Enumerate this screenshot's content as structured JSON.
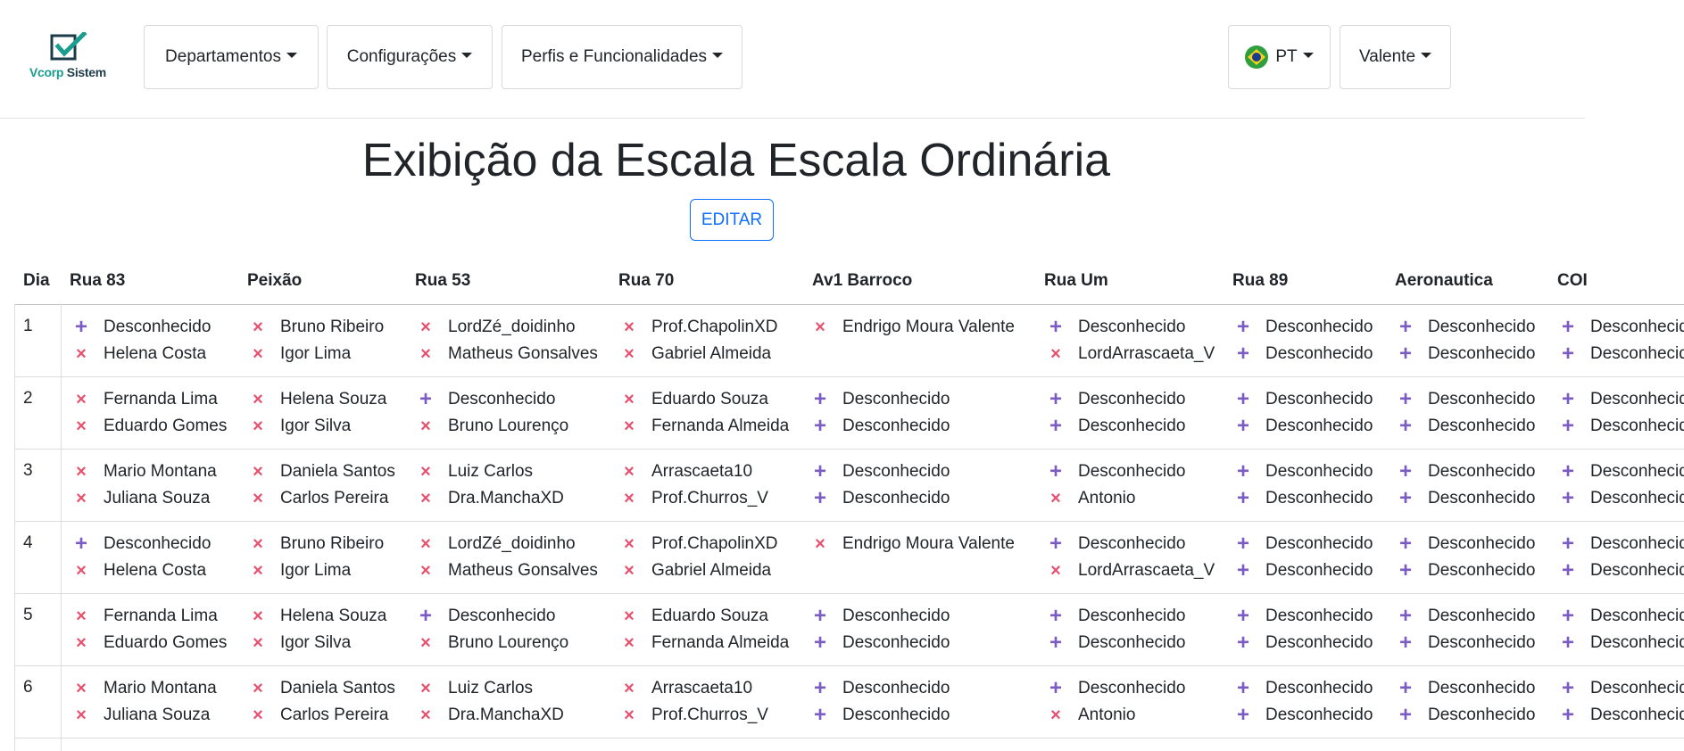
{
  "logo": {
    "part1": "Vcorp",
    "part2": "Sistem"
  },
  "nav": {
    "departamentos": "Departamentos",
    "configuracoes": "Configurações",
    "perfis": "Perfis e Funcionalidades",
    "language": "PT",
    "user": "Valente"
  },
  "page": {
    "title": "Exibição da Escala Escala Ordinária",
    "edit_label": "EDITAR"
  },
  "icons": {
    "x": "×",
    "plus": "+",
    "remove_icon": "x-icon",
    "add_icon": "plus-icon",
    "flag_icon": "brazil-flag-icon"
  },
  "colors": {
    "x": "#e8506d",
    "plus": "#7b5cc4",
    "accent": "#0d6efd",
    "logo_teal": "#1a9c8e"
  },
  "table": {
    "headers": [
      "Dia",
      "Rua 83",
      "Peixão",
      "Rua 53",
      "Rua 70",
      "Av1 Barroco",
      "Rua Um",
      "Rua 89",
      "Aeronautica",
      "COI"
    ],
    "rows": [
      {
        "day": "1",
        "cells": [
          [
            {
              "m": "plus",
              "n": "Desconhecido"
            },
            {
              "m": "x",
              "n": "Helena Costa"
            }
          ],
          [
            {
              "m": "x",
              "n": "Bruno Ribeiro"
            },
            {
              "m": "x",
              "n": "Igor Lima"
            }
          ],
          [
            {
              "m": "x",
              "n": "LordZé_doidinho"
            },
            {
              "m": "x",
              "n": "Matheus Gonsalves"
            }
          ],
          [
            {
              "m": "x",
              "n": "Prof.ChapolinXD"
            },
            {
              "m": "x",
              "n": "Gabriel Almeida"
            }
          ],
          [
            {
              "m": "x",
              "n": "Endrigo Moura Valente"
            }
          ],
          [
            {
              "m": "plus",
              "n": "Desconhecido"
            },
            {
              "m": "x",
              "n": "LordArrascaeta_V"
            }
          ],
          [
            {
              "m": "plus",
              "n": "Desconhecido"
            },
            {
              "m": "plus",
              "n": "Desconhecido"
            }
          ],
          [
            {
              "m": "plus",
              "n": "Desconhecido"
            },
            {
              "m": "plus",
              "n": "Desconhecido"
            }
          ],
          [
            {
              "m": "plus",
              "n": "Desconhecido"
            },
            {
              "m": "plus",
              "n": "Desconhecido"
            }
          ]
        ]
      },
      {
        "day": "2",
        "cells": [
          [
            {
              "m": "x",
              "n": "Fernanda Lima"
            },
            {
              "m": "x",
              "n": "Eduardo Gomes"
            }
          ],
          [
            {
              "m": "x",
              "n": "Helena Souza"
            },
            {
              "m": "x",
              "n": "Igor Silva"
            }
          ],
          [
            {
              "m": "plus",
              "n": "Desconhecido"
            },
            {
              "m": "x",
              "n": "Bruno Lourenço"
            }
          ],
          [
            {
              "m": "x",
              "n": "Eduardo Souza"
            },
            {
              "m": "x",
              "n": "Fernanda Almeida"
            }
          ],
          [
            {
              "m": "plus",
              "n": "Desconhecido"
            },
            {
              "m": "plus",
              "n": "Desconhecido"
            }
          ],
          [
            {
              "m": "plus",
              "n": "Desconhecido"
            },
            {
              "m": "plus",
              "n": "Desconhecido"
            }
          ],
          [
            {
              "m": "plus",
              "n": "Desconhecido"
            },
            {
              "m": "plus",
              "n": "Desconhecido"
            }
          ],
          [
            {
              "m": "plus",
              "n": "Desconhecido"
            },
            {
              "m": "plus",
              "n": "Desconhecido"
            }
          ],
          [
            {
              "m": "plus",
              "n": "Desconhecido"
            },
            {
              "m": "plus",
              "n": "Desconhecido"
            }
          ]
        ]
      },
      {
        "day": "3",
        "cells": [
          [
            {
              "m": "x",
              "n": "Mario Montana"
            },
            {
              "m": "x",
              "n": "Juliana Souza"
            }
          ],
          [
            {
              "m": "x",
              "n": "Daniela Santos"
            },
            {
              "m": "x",
              "n": "Carlos Pereira"
            }
          ],
          [
            {
              "m": "x",
              "n": "Luiz Carlos"
            },
            {
              "m": "x",
              "n": "Dra.ManchaXD"
            }
          ],
          [
            {
              "m": "x",
              "n": "Arrascaeta10"
            },
            {
              "m": "x",
              "n": "Prof.Churros_V"
            }
          ],
          [
            {
              "m": "plus",
              "n": "Desconhecido"
            },
            {
              "m": "plus",
              "n": "Desconhecido"
            }
          ],
          [
            {
              "m": "plus",
              "n": "Desconhecido"
            },
            {
              "m": "x",
              "n": "Antonio"
            }
          ],
          [
            {
              "m": "plus",
              "n": "Desconhecido"
            },
            {
              "m": "plus",
              "n": "Desconhecido"
            }
          ],
          [
            {
              "m": "plus",
              "n": "Desconhecido"
            },
            {
              "m": "plus",
              "n": "Desconhecido"
            }
          ],
          [
            {
              "m": "plus",
              "n": "Desconhecido"
            },
            {
              "m": "plus",
              "n": "Desconhecido"
            }
          ]
        ]
      },
      {
        "day": "4",
        "cells": [
          [
            {
              "m": "plus",
              "n": "Desconhecido"
            },
            {
              "m": "x",
              "n": "Helena Costa"
            }
          ],
          [
            {
              "m": "x",
              "n": "Bruno Ribeiro"
            },
            {
              "m": "x",
              "n": "Igor Lima"
            }
          ],
          [
            {
              "m": "x",
              "n": "LordZé_doidinho"
            },
            {
              "m": "x",
              "n": "Matheus Gonsalves"
            }
          ],
          [
            {
              "m": "x",
              "n": "Prof.ChapolinXD"
            },
            {
              "m": "x",
              "n": "Gabriel Almeida"
            }
          ],
          [
            {
              "m": "x",
              "n": "Endrigo Moura Valente"
            }
          ],
          [
            {
              "m": "plus",
              "n": "Desconhecido"
            },
            {
              "m": "x",
              "n": "LordArrascaeta_V"
            }
          ],
          [
            {
              "m": "plus",
              "n": "Desconhecido"
            },
            {
              "m": "plus",
              "n": "Desconhecido"
            }
          ],
          [
            {
              "m": "plus",
              "n": "Desconhecido"
            },
            {
              "m": "plus",
              "n": "Desconhecido"
            }
          ],
          [
            {
              "m": "plus",
              "n": "Desconhecido"
            },
            {
              "m": "plus",
              "n": "Desconhecido"
            }
          ]
        ]
      },
      {
        "day": "5",
        "cells": [
          [
            {
              "m": "x",
              "n": "Fernanda Lima"
            },
            {
              "m": "x",
              "n": "Eduardo Gomes"
            }
          ],
          [
            {
              "m": "x",
              "n": "Helena Souza"
            },
            {
              "m": "x",
              "n": "Igor Silva"
            }
          ],
          [
            {
              "m": "plus",
              "n": "Desconhecido"
            },
            {
              "m": "x",
              "n": "Bruno Lourenço"
            }
          ],
          [
            {
              "m": "x",
              "n": "Eduardo Souza"
            },
            {
              "m": "x",
              "n": "Fernanda Almeida"
            }
          ],
          [
            {
              "m": "plus",
              "n": "Desconhecido"
            },
            {
              "m": "plus",
              "n": "Desconhecido"
            }
          ],
          [
            {
              "m": "plus",
              "n": "Desconhecido"
            },
            {
              "m": "plus",
              "n": "Desconhecido"
            }
          ],
          [
            {
              "m": "plus",
              "n": "Desconhecido"
            },
            {
              "m": "plus",
              "n": "Desconhecido"
            }
          ],
          [
            {
              "m": "plus",
              "n": "Desconhecido"
            },
            {
              "m": "plus",
              "n": "Desconhecido"
            }
          ],
          [
            {
              "m": "plus",
              "n": "Desconhecido"
            },
            {
              "m": "plus",
              "n": "Desconhecido"
            }
          ]
        ]
      },
      {
        "day": "6",
        "cells": [
          [
            {
              "m": "x",
              "n": "Mario Montana"
            },
            {
              "m": "x",
              "n": "Juliana Souza"
            }
          ],
          [
            {
              "m": "x",
              "n": "Daniela Santos"
            },
            {
              "m": "x",
              "n": "Carlos Pereira"
            }
          ],
          [
            {
              "m": "x",
              "n": "Luiz Carlos"
            },
            {
              "m": "x",
              "n": "Dra.ManchaXD"
            }
          ],
          [
            {
              "m": "x",
              "n": "Arrascaeta10"
            },
            {
              "m": "x",
              "n": "Prof.Churros_V"
            }
          ],
          [
            {
              "m": "plus",
              "n": "Desconhecido"
            },
            {
              "m": "plus",
              "n": "Desconhecido"
            }
          ],
          [
            {
              "m": "plus",
              "n": "Desconhecido"
            },
            {
              "m": "x",
              "n": "Antonio"
            }
          ],
          [
            {
              "m": "plus",
              "n": "Desconhecido"
            },
            {
              "m": "plus",
              "n": "Desconhecido"
            }
          ],
          [
            {
              "m": "plus",
              "n": "Desconhecido"
            },
            {
              "m": "plus",
              "n": "Desconhecido"
            }
          ],
          [
            {
              "m": "plus",
              "n": "Desconhecido"
            },
            {
              "m": "plus",
              "n": "Desconhecido"
            }
          ]
        ]
      }
    ]
  }
}
